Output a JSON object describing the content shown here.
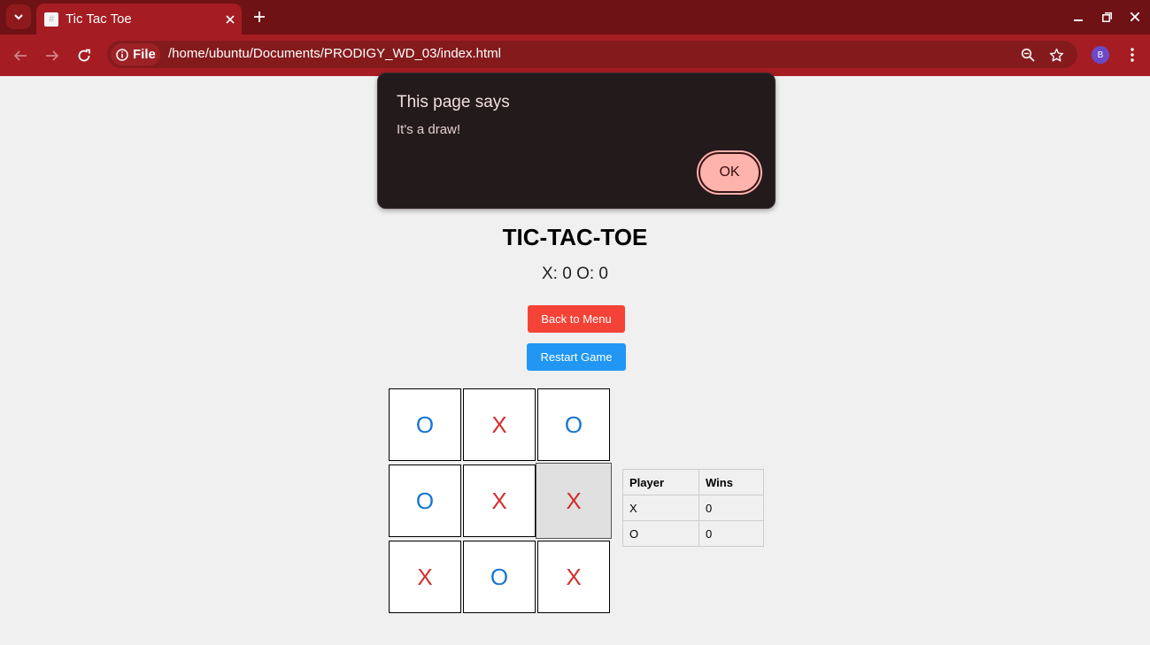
{
  "browser": {
    "tab_title": "Tic Tac Toe",
    "chip_label": "File",
    "url": "/home/ubuntu/Documents/PRODIGY_WD_03/index.html",
    "profile_initial": "B",
    "theme_color": "#a51d22"
  },
  "dialog": {
    "title": "This page says",
    "message": "It's a draw!",
    "ok_label": "OK"
  },
  "game": {
    "title": "TIC-TAC-TOE",
    "score_text": "X: 0 O: 0",
    "back_label": "Back to Menu",
    "restart_label": "Restart Game",
    "board": [
      "O",
      "X",
      "O",
      "O",
      "X",
      "X",
      "X",
      "O",
      "X"
    ],
    "x_color": "#d32f2f",
    "o_color": "#1976d2"
  },
  "wins_table": {
    "headers": [
      "Player",
      "Wins"
    ],
    "rows": [
      {
        "player": "X",
        "wins": "0"
      },
      {
        "player": "O",
        "wins": "0"
      }
    ]
  }
}
